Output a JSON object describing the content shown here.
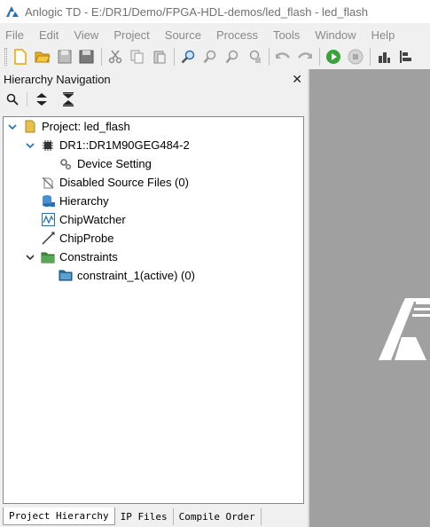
{
  "window": {
    "title": "Anlogic TD - E:/DR1/Demo/FPGA-HDL-demos/led_flash - led_flash"
  },
  "menu": [
    "File",
    "Edit",
    "View",
    "Project",
    "Source",
    "Process",
    "Tools",
    "Window",
    "Help"
  ],
  "panel": {
    "title": "Hierarchy Navigation",
    "close": "✕"
  },
  "tree": {
    "project": "Project: led_flash",
    "device": "DR1::DR1M90GEG484-2",
    "device_setting": "Device Setting",
    "disabled": "Disabled Source Files (0)",
    "hierarchy": "Hierarchy",
    "chipwatcher": "ChipWatcher",
    "chipprobe": "ChipProbe",
    "constraints": "Constraints",
    "constraint_item": "constraint_1(active) (0)"
  },
  "tabs": [
    "Project Hierarchy",
    "IP Files",
    "Compile Order"
  ],
  "colors": {
    "accent": "#1e6fb5",
    "workspace": "#a0a0a0",
    "run_green": "#3aa33a"
  }
}
